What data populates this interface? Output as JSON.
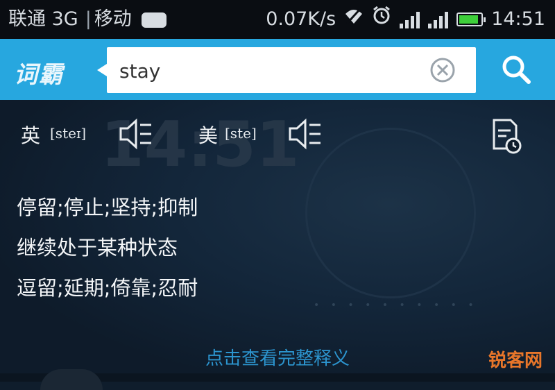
{
  "status_bar": {
    "carrier1": "联通 3G",
    "separator": "|",
    "carrier2": "移动",
    "speed": "0.07K/s",
    "time": "14:51",
    "battery_level": 0.9
  },
  "header": {
    "logo_text": "词霸",
    "search_value": "stay",
    "search_placeholder": ""
  },
  "pronunciation": {
    "uk_label": "英",
    "uk_ipa": "[steɪ]",
    "us_label": "美",
    "us_ipa": "[ste]"
  },
  "background": {
    "clock_digits": "14:51"
  },
  "definitions": [
    "停留;停止;坚持;抑制",
    "继续处于某种状态",
    "逗留;延期;倚靠;忍耐"
  ],
  "more_link": "点击查看完整释义",
  "watermark": "锐客网",
  "colors": {
    "accent": "#27a7df",
    "link": "#2c95cf",
    "background": "#0f1d2c",
    "watermark": "#e8762a"
  }
}
